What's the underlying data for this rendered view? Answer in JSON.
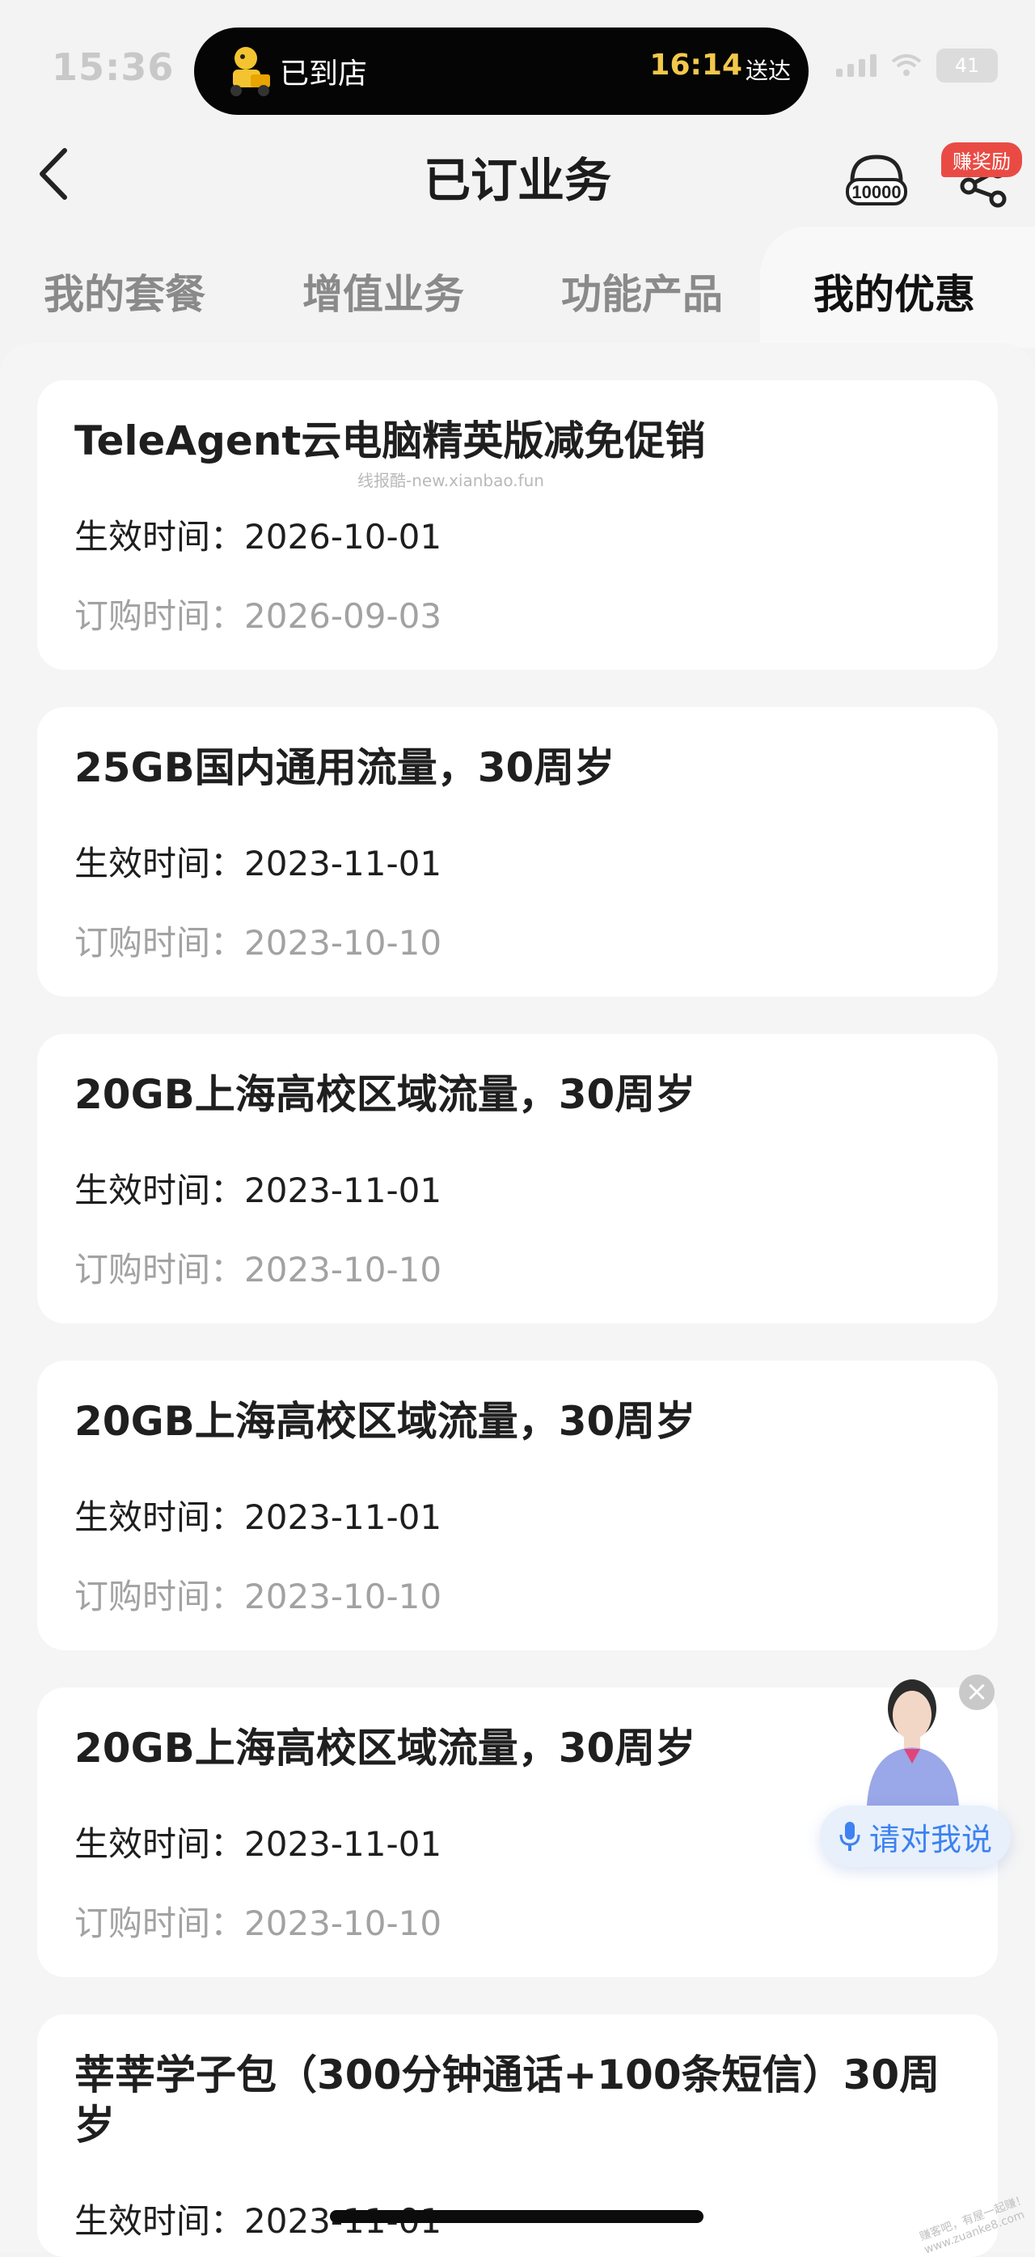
{
  "status_bar": {
    "time": "15:36",
    "battery": "41"
  },
  "island": {
    "text": "已到店",
    "eta": "16:14",
    "deliver": "送达"
  },
  "header": {
    "title": "已订业务",
    "service_number": "10000",
    "reward_badge": "赚奖励"
  },
  "tabs": [
    {
      "label": "我的套餐",
      "active": false
    },
    {
      "label": "增值业务",
      "active": false
    },
    {
      "label": "功能产品",
      "active": false
    },
    {
      "label": "我的优惠",
      "active": true
    }
  ],
  "watermark": "线报酷-new.xianbao.fun",
  "cards": [
    {
      "title": "TeleAgent云电脑精英版减免促销",
      "effective_label": "生效时间：",
      "effective": "2026-10-01",
      "order_label": "订购时间：",
      "order": "2026-09-03"
    },
    {
      "title": "25GB国内通用流量，30周岁",
      "effective_label": "生效时间：",
      "effective": "2023-11-01",
      "order_label": "订购时间：",
      "order": "2023-10-10"
    },
    {
      "title": "20GB上海高校区域流量，30周岁",
      "effective_label": "生效时间：",
      "effective": "2023-11-01",
      "order_label": "订购时间：",
      "order": "2023-10-10"
    },
    {
      "title": "20GB上海高校区域流量，30周岁",
      "effective_label": "生效时间：",
      "effective": "2023-11-01",
      "order_label": "订购时间：",
      "order": "2023-10-10"
    },
    {
      "title": "20GB上海高校区域流量，30周岁",
      "effective_label": "生效时间：",
      "effective": "2023-11-01",
      "order_label": "订购时间：",
      "order": "2023-10-10"
    },
    {
      "title": "莘莘学子包（300分钟通话+100条短信）30周岁",
      "effective_label": "生效时间：",
      "effective": "2023-11-01"
    }
  ],
  "assistant": {
    "button_label": "请对我说",
    "close": "×"
  },
  "corner_watermark": "赚客吧，有屋一起赚！www.zuanke8.com"
}
